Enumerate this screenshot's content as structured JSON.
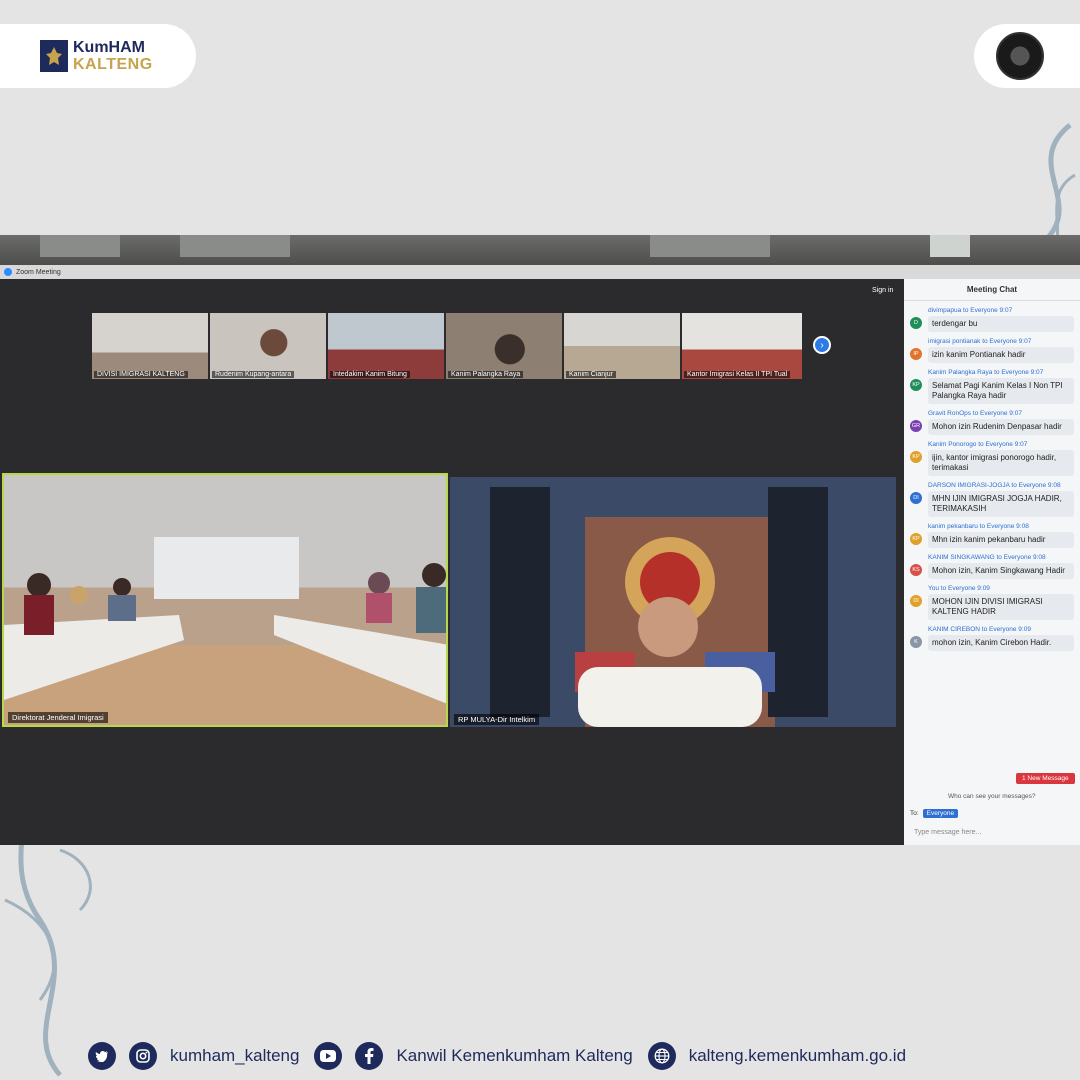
{
  "brand": {
    "line1": "KumHAM",
    "line2": "KALTENG"
  },
  "zoom": {
    "window_title": "Zoom Meeting",
    "sign_in": "Sign in"
  },
  "thumbnails": [
    {
      "label": "DIVISI IMIGRASI KALTENG"
    },
    {
      "label": "Rudenim Kupang-antara"
    },
    {
      "label": "Intedakim Kanim Bitung"
    },
    {
      "label": "Kanim Palangka Raya"
    },
    {
      "label": "Kanim Cianjur"
    },
    {
      "label": "Kantor Imigrasi Kelas II TPI Tual"
    }
  ],
  "tiles": {
    "left_label": "Direktorat Jenderal Imigrasi",
    "right_label": "RP MULYA-Dir Intelkim"
  },
  "chat": {
    "title": "Meeting Chat",
    "messages": [
      {
        "initials": "D",
        "color": "#1f8f5a",
        "from": "divimpapua to Everyone 9:07",
        "text": "terdengar bu"
      },
      {
        "initials": "IP",
        "color": "#e0742a",
        "from": "imigrasi pontianak to Everyone 9:07",
        "text": "izin kanim Pontianak hadir"
      },
      {
        "initials": "KP",
        "color": "#1f8f5a",
        "from": "Kanim Palangka Raya to Everyone 9:07",
        "text": "Selamat Pagi Kanim Kelas I Non TPI Palangka Raya hadir"
      },
      {
        "initials": "GR",
        "color": "#7a3fb0",
        "from": "Gravit RonOps to Everyone 9:07",
        "text": "Mohon izin Rudenim Denpasar hadir"
      },
      {
        "initials": "KP",
        "color": "#e0a02a",
        "from": "Kanim Ponorogo to Everyone 9:07",
        "text": "ijin, kantor imigrasi ponorogo hadir, terimakasi"
      },
      {
        "initials": "DI",
        "color": "#2d6fd2",
        "from": "DARSON IMIGRASI-JOGJA to Everyone 9:08",
        "text": "MHN IJIN IMIGRASI JOGJA HADIR, TERIMAKASIH"
      },
      {
        "initials": "KP",
        "color": "#e0a02a",
        "from": "kanim pekanbaru to Everyone 9:08",
        "text": "Mhn izin kanim pekanbaru hadir"
      },
      {
        "initials": "KS",
        "color": "#d9504a",
        "from": "KANIM SINGKAWANG to Everyone 9:08",
        "text": "Mohon izin, Kanim Singkawang Hadir"
      },
      {
        "initials": "DI",
        "color": "#e0a02a",
        "from": "You to Everyone 9:09",
        "text": "MOHON IJIN DIVISI IMIGRASI KALTENG HADIR"
      },
      {
        "initials": "K",
        "color": "#8a95a5",
        "from": "KANIM CIREBON to Everyone 9:09",
        "text": "mohon izin, Kanim Cirebon Hadir."
      }
    ],
    "new_message": "1 New Message",
    "who_can_see": "Who can see your messages?",
    "to_label": "To:",
    "recipient": "Everyone",
    "input_placeholder": "Type message here..."
  },
  "footer": {
    "social_handle": "kumham_kalteng",
    "facebook_name": "Kanwil Kemenkumham Kalteng",
    "website": "kalteng.kemenkumham.go.id"
  }
}
